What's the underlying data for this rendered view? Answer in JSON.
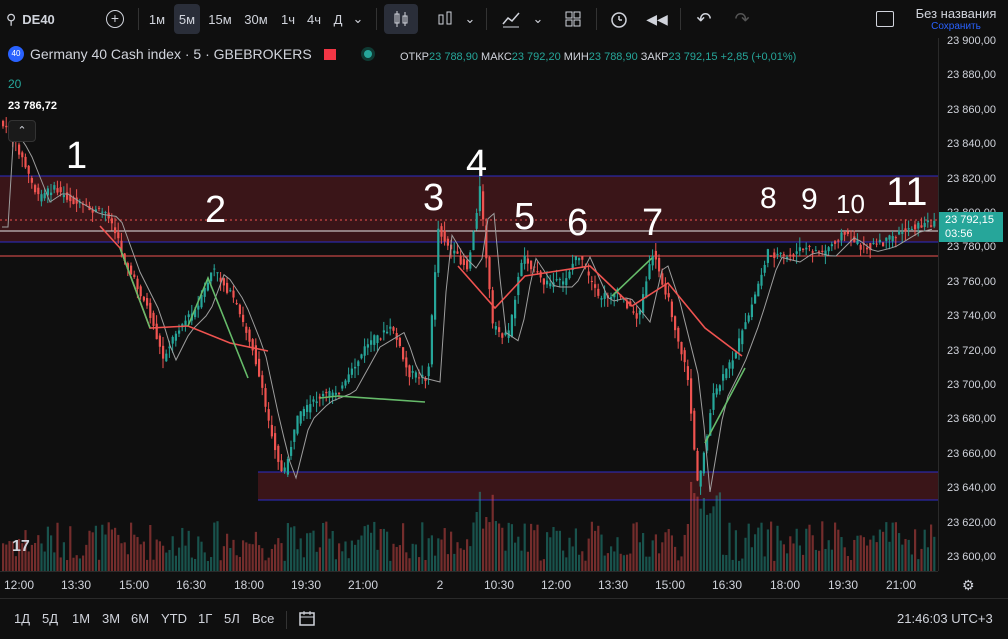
{
  "toolbar": {
    "symbol": "DE40",
    "intervals": [
      "1м",
      "5м",
      "15м",
      "30м",
      "1ч",
      "4ч",
      "Д"
    ],
    "active_interval": "5м",
    "layout_title": "Без названия",
    "save_label": "Сохранить"
  },
  "legend": {
    "badge": "40",
    "title": "Germany 40 Cash index · 5 · GBEBROKERS",
    "indicator": "20",
    "ma_value": "23 786,72",
    "open_label": "ОТКР",
    "open": "23 788,90",
    "high_label": "МАКС",
    "high": "23 792,20",
    "low_label": "МИН",
    "low": "23 788,90",
    "close_label": "ЗАКР",
    "close": "23 792,15",
    "change": "+2,85 (+0,01%)"
  },
  "price_axis": {
    "labels": [
      "23 900,00",
      "23 880,00",
      "23 860,00",
      "23 840,00",
      "23 820,00",
      "23 800,00",
      "23 780,00",
      "23 760,00",
      "23 740,00",
      "23 720,00",
      "23 700,00",
      "23 680,00",
      "23 660,00",
      "23 640,00",
      "23 620,00",
      "23 600,00"
    ],
    "current_price": "23 792,15",
    "countdown": "03:56"
  },
  "time_axis": {
    "labels": [
      "12:00",
      "13:30",
      "15:00",
      "16:30",
      "18:00",
      "19:30",
      "21:00",
      "2",
      "10:30",
      "12:00",
      "13:30",
      "15:00",
      "16:30",
      "18:00",
      "19:30",
      "21:00"
    ]
  },
  "annotations": [
    "1",
    "2",
    "3",
    "4",
    "5",
    "6",
    "7",
    "8",
    "9",
    "10",
    "11"
  ],
  "bottom": {
    "ranges": [
      "1Д",
      "5Д",
      "1М",
      "3М",
      "6М",
      "YTD",
      "1Г",
      "5Л",
      "Все"
    ],
    "clock": "21:46:03 UTC+3"
  },
  "colors": {
    "up": "#26a69a",
    "down": "#ef5350",
    "zone": "#3a1518",
    "zone_border": "#2c2cc8"
  }
}
